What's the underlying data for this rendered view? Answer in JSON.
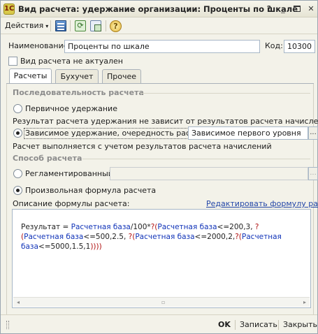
{
  "window": {
    "title": "Вид расчета: удержание организации: Проценты по шкале",
    "app_icon_glyph": "1С",
    "help_glyph": "?",
    "minimize_glyph": "_",
    "close_glyph": "✕"
  },
  "toolbar": {
    "actions_label": "Действия",
    "actions_arrow": "▾",
    "help_glyph": "?",
    "icons": [
      "document-list-icon",
      "refresh-icon",
      "copy-icon",
      "help-icon"
    ]
  },
  "form": {
    "name_label": "Наименование:",
    "name_value": "Проценты по шкале",
    "code_label": "Код:",
    "code_value": "10300",
    "inactive_label": "Вид расчета не актуален",
    "inactive_checked": false
  },
  "tabs": [
    {
      "label": "Расчеты",
      "active": true
    },
    {
      "label": "Бухучет",
      "active": false
    },
    {
      "label": "Прочее",
      "active": false
    }
  ],
  "sequence": {
    "section_title": "Последовательность расчета",
    "primary_label": "Первичное удержание",
    "primary_note": "Результат расчета удержания не зависит от результатов расчета начислений",
    "dependent_label": "Зависимое удержание, очередность расчета:",
    "dependent_value": "Зависимое первого уровня",
    "dependent_note": "Расчет выполняется с учетом результатов расчета начислений",
    "select_button": "...",
    "selected": "dependent"
  },
  "method": {
    "section_title": "Способ расчета",
    "regulated_label": "Регламентированный:",
    "regulated_value": "",
    "select_button": "...",
    "arbitrary_label": "Произвольная формула расчета",
    "selected": "arbitrary",
    "description_label": "Описание формулы расчета:",
    "edit_link": "Редактировать формулу расчета"
  },
  "formula": {
    "parts": [
      {
        "t": "Результат = ",
        "c": "fixed"
      },
      {
        "t": "Расчетная база",
        "c": "var"
      },
      {
        "t": "/100*",
        "c": "fixed"
      },
      {
        "t": "?(",
        "c": "op"
      },
      {
        "t": "Расчетная база",
        "c": "var"
      },
      {
        "t": "<=200,3, ",
        "c": "fixed"
      },
      {
        "t": "?(",
        "c": "op"
      },
      {
        "t": "Расчетная база",
        "c": "var"
      },
      {
        "t": "<=500,2.5, ",
        "c": "fixed"
      },
      {
        "t": "?(",
        "c": "op"
      },
      {
        "t": "Расчетная база",
        "c": "var"
      },
      {
        "t": "<=2000,2,",
        "c": "fixed"
      },
      {
        "t": "?(",
        "c": "op"
      },
      {
        "t": "Расчетная база",
        "c": "var"
      },
      {
        "t": "<=5000,1.5,1",
        "c": "fixed"
      },
      {
        "t": "))))",
        "c": "op"
      }
    ],
    "scroll_left": "◂",
    "scroll_right": "▸",
    "scroll_thumb": "▫"
  },
  "footer": {
    "ok_label": "OK",
    "save_label": "Записать",
    "close_label": "Закрыть"
  },
  "colors": {
    "accent_link": "#2246a8",
    "formula_variable": "#1033b8",
    "formula_operator": "#b01010",
    "section_title": "#8c8c8c"
  }
}
